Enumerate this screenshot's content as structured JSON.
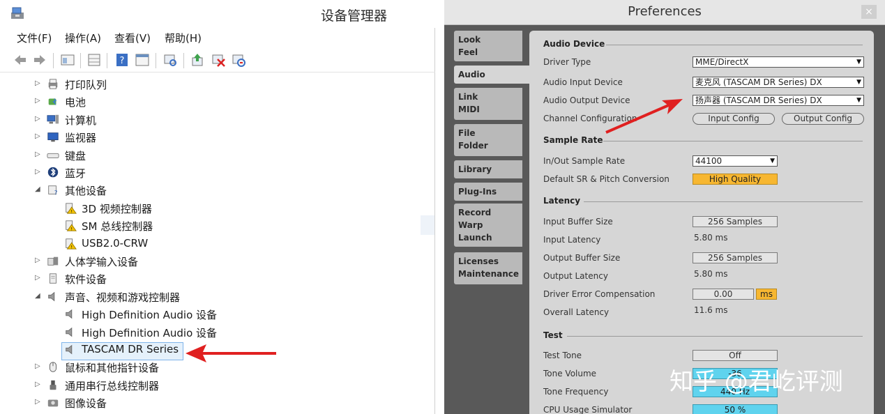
{
  "device_manager": {
    "title": "设备管理器",
    "menu": [
      "文件(F)",
      "操作(A)",
      "查看(V)",
      "帮助(H)"
    ],
    "toolbar_icons": [
      "back-arrow-icon",
      "forward-arrow-icon",
      "computer-props-icon",
      "grid-icon",
      "help-icon",
      "window-icon",
      "scan-icon",
      "update-driver-icon",
      "disable-device-icon",
      "uninstall-device-icon"
    ],
    "tree": [
      {
        "label": "打印队列",
        "icon": "printer-icon",
        "state": "collapsed"
      },
      {
        "label": "电池",
        "icon": "battery-icon",
        "state": "collapsed"
      },
      {
        "label": "计算机",
        "icon": "computer-icon",
        "state": "collapsed"
      },
      {
        "label": "监视器",
        "icon": "monitor-icon",
        "state": "collapsed"
      },
      {
        "label": "键盘",
        "icon": "keyboard-icon",
        "state": "collapsed"
      },
      {
        "label": "蓝牙",
        "icon": "bluetooth-icon",
        "state": "collapsed"
      },
      {
        "label": "其他设备",
        "icon": "unknown-device-icon",
        "state": "expanded"
      },
      {
        "label": "3D 视频控制器",
        "icon": "warning-device-icon",
        "child": true
      },
      {
        "label": "SM 总线控制器",
        "icon": "warning-device-icon",
        "child": true
      },
      {
        "label": "USB2.0-CRW",
        "icon": "warning-device-icon",
        "child": true
      },
      {
        "label": "人体学输入设备",
        "icon": "hid-icon",
        "state": "collapsed"
      },
      {
        "label": "软件设备",
        "icon": "software-device-icon",
        "state": "collapsed"
      },
      {
        "label": "声音、视频和游戏控制器",
        "icon": "speaker-icon",
        "state": "expanded"
      },
      {
        "label": "High Definition Audio 设备",
        "icon": "speaker-icon",
        "child": true
      },
      {
        "label": "High Definition Audio 设备",
        "icon": "speaker-icon",
        "child": true
      },
      {
        "label": "TASCAM DR Series",
        "icon": "speaker-icon",
        "child": true,
        "selected": true
      },
      {
        "label": "鼠标和其他指针设备",
        "icon": "mouse-icon",
        "state": "collapsed"
      },
      {
        "label": "通用串行总线控制器",
        "icon": "usb-icon",
        "state": "collapsed"
      },
      {
        "label": "图像设备",
        "icon": "camera-icon",
        "state": "collapsed"
      }
    ]
  },
  "preferences": {
    "title": "Preferences",
    "close_label": "×",
    "tabs": [
      {
        "label": "Look\nFeel"
      },
      {
        "label": "Audio",
        "active": true
      },
      {
        "label": "Link\nMIDI"
      },
      {
        "label": "File\nFolder"
      },
      {
        "label": "Library"
      },
      {
        "label": "Plug-Ins"
      },
      {
        "label": "Record\nWarp\nLaunch"
      },
      {
        "label": "Licenses\nMaintenance"
      }
    ],
    "audio_device": {
      "heading": "Audio Device",
      "driver_type_label": "Driver Type",
      "driver_type_value": "MME/DirectX",
      "input_device_label": "Audio Input Device",
      "input_device_value": "麦克风 (TASCAM DR Series) DX",
      "output_device_label": "Audio Output Device",
      "output_device_value": "扬声器 (TASCAM DR Series) DX",
      "channel_config_label": "Channel Configuration",
      "input_config_button": "Input Config",
      "output_config_button": "Output Config"
    },
    "sample_rate": {
      "heading": "Sample Rate",
      "inout_label": "In/Out Sample Rate",
      "inout_value": "44100",
      "default_sr_label": "Default SR & Pitch Conversion",
      "default_sr_value": "High Quality"
    },
    "latency": {
      "heading": "Latency",
      "input_buffer_label": "Input Buffer Size",
      "input_buffer_value": "256 Samples",
      "input_latency_label": "Input Latency",
      "input_latency_value": "5.80 ms",
      "output_buffer_label": "Output Buffer Size",
      "output_buffer_value": "256 Samples",
      "output_latency_label": "Output Latency",
      "output_latency_value": "5.80 ms",
      "driver_error_label": "Driver Error Compensation",
      "driver_error_value": "0.00",
      "driver_error_unit": "ms",
      "overall_latency_label": "Overall Latency",
      "overall_latency_value": "11.6 ms"
    },
    "test": {
      "heading": "Test",
      "test_tone_label": "Test Tone",
      "test_tone_value": "Off",
      "tone_volume_label": "Tone Volume",
      "tone_volume_value": "-36",
      "tone_frequency_label": "Tone Frequency",
      "tone_frequency_value": "440 Hz",
      "cpu_sim_label": "CPU Usage Simulator",
      "cpu_sim_value": "50 %"
    }
  },
  "watermark": "知乎 @君屹评测",
  "colors": {
    "annotation_arrow": "#e02020",
    "high_quality": "#f7b731",
    "cyan_value": "#5fd3ee",
    "selection": "#e5f1fb"
  }
}
